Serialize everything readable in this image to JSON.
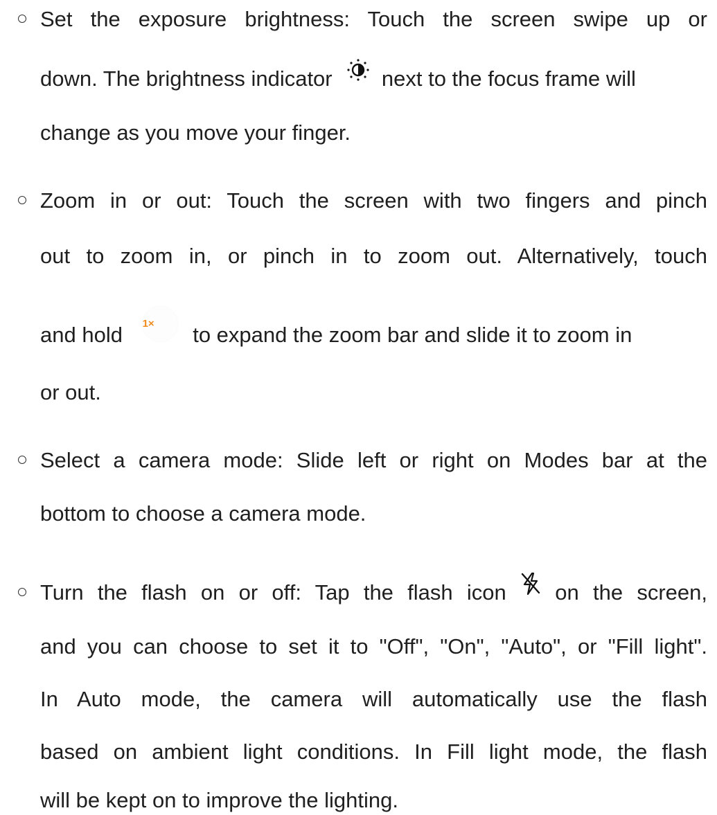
{
  "items": [
    {
      "lines": [
        "Set the exposure brightness: Touch the screen swipe up or",
        [
          "down. The brightness indicator",
          "next to the focus frame will"
        ],
        "change as you move your finger."
      ],
      "icon": "brightness-icon"
    },
    {
      "lines": [
        "Zoom in or out: Touch the screen with two fingers and pinch",
        "out to zoom in, or pinch in to zoom out. Alternatively, touch",
        [
          "and hold",
          "to expand the zoom bar and slide it to zoom in"
        ],
        "or out."
      ],
      "icon": "zoom-1x-icon",
      "zoom_label": "1×"
    },
    {
      "lines": [
        "Select a camera mode: Slide left or right on Modes bar at the",
        "bottom to choose a camera mode."
      ]
    },
    {
      "lines": [
        [
          "Turn the flash on or off: Tap the flash icon",
          "on the screen,"
        ],
        "and you can choose to set it to \"Off\", \"On\", \"Auto\", or \"Fill light\".",
        "In Auto mode, the camera will automatically use the flash",
        "based on ambient light conditions. In Fill light mode, the flash",
        "will be kept on to improve the lighting."
      ],
      "icon": "flash-off-icon"
    }
  ]
}
